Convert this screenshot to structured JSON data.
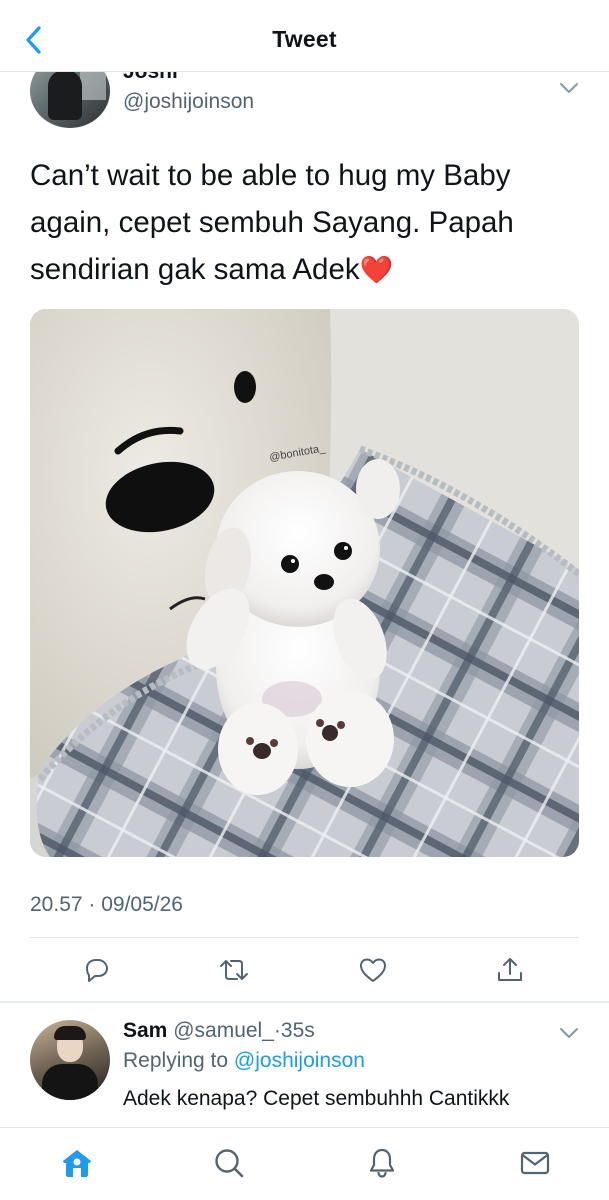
{
  "header": {
    "title": "Tweet",
    "back_icon": "chevron-left-icon"
  },
  "tweet": {
    "author_name": "Joshi",
    "author_handle": "@joshijoinson",
    "text": "Can’t wait to be able to hug my Baby again, cepet sembuh Sayang. Papah sendirian gak sama Adek",
    "emoji": "❤️",
    "image_watermark": "@bonitota_",
    "timestamp": "20.57 · 09/05/26",
    "actions": [
      "reply-icon",
      "retweet-icon",
      "like-icon",
      "share-icon"
    ]
  },
  "reply": {
    "name": "Sam",
    "handle": "@samuel_",
    "separator": "·",
    "time": "35s",
    "replying_prefix": "Replying to",
    "replying_to": "@joshijoinson",
    "text": "Adek kenapa? Cepet sembuhhh Cantikkk"
  },
  "tabbar": {
    "items": [
      "home-icon",
      "search-icon",
      "notifications-icon",
      "messages-icon"
    ]
  },
  "colors": {
    "accent": "#1d9bf0",
    "text": "#0f1419",
    "secondary": "#536471",
    "heart": "#e0245e"
  }
}
